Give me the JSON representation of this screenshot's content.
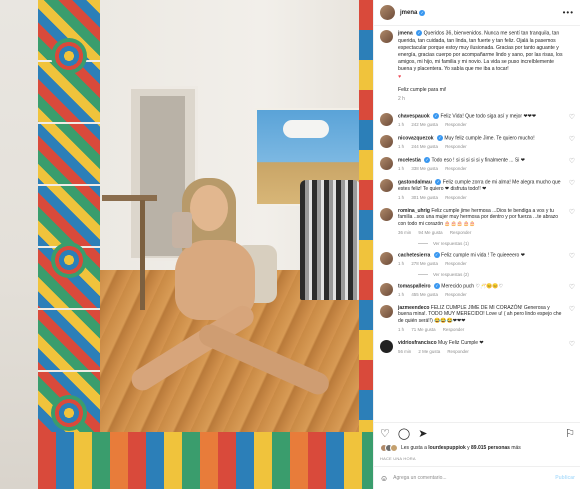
{
  "post": {
    "username": "jmena",
    "caption": "Queridos 36, bienvenidos. Nunca me sentí tan tranquila, tan querida, tan cuidada, tan linda, tan fuerte y tan feliz. Ojalá la pasemos espectacular porque estoy muy ilusionada. Gracias por tanto aguante y energía, gracias cuerpo por acompañarme lindo y sano, por las risas, los amigos, mi hijo, mi familia y mi novio. La vida se puso increíblemente buena y placentera. Yo sabía que me iba a tocar!",
    "caption_heart": "♥",
    "caption_sign": "Feliz cumple para mi!",
    "caption_time": "2 h"
  },
  "comments": [
    {
      "username": "chavespauok",
      "text": "Feliz Vida! Que todo siga así y mejor ❤❤❤",
      "time": "1 h",
      "likes": "242 Me gusta",
      "reply": "Responder"
    },
    {
      "username": "nicovazquezok",
      "text": "Muy feliz cumple Jime. Te quiero mucho!",
      "time": "1 h",
      "likes": "244 Me gusta",
      "reply": "Responder"
    },
    {
      "username": "mcelestia",
      "text": "Todo eso ! si si si si si y finalmente ... Si ❤",
      "time": "1 h",
      "likes": "338 Me gusta",
      "reply": "Responder"
    },
    {
      "username": "gastondalmau",
      "text": "Feliz cumple zorra de mi alma! Me alegra mucho que estes feliz! Te quiero ❤ disfruta todo!! ❤",
      "time": "1 h",
      "likes": "301 Me gusta",
      "reply": "Responder"
    },
    {
      "username": "romina_uhrig",
      "text": "Feliz cumple jime hermosa ...Dios te bendiga a vos y tu familia ..sos una mujer muy hermosa por dentro y por fuerza ...te abrazo con todo mi corazón 🎂🎂🎂🎂🎂",
      "time": "36 min",
      "likes": "94 Me gusta",
      "reply": "Responder",
      "replies": "Ver respuestas (1)"
    },
    {
      "username": "cachetesierra",
      "text": "Feliz cumple mi vida ! Te quieeeero ❤",
      "time": "1 h",
      "likes": "278 Me gusta",
      "reply": "Responder",
      "replies": "Ver respuestas (2)"
    },
    {
      "username": "tomaspalleiro",
      "text": "Merecido puch ♡🥂😊😊♡",
      "time": "1 h",
      "likes": "455 Me gusta",
      "reply": "Responder"
    },
    {
      "username": "jazmeendeco",
      "text": "FELIZ CUMPLE JIME DE MI CORAZÓN! Generosa y buena mina!. TODO MUY MERECIDO! Love u! ( ah pero lindo espejo che de quién será!!) 😂😂😂❤❤❤",
      "time": "1 h",
      "likes": "71 Me gusta",
      "reply": "Responder"
    },
    {
      "username": "vidriosfrancisco",
      "text": "Muy Feliz Cumple ❤",
      "time": "56 min",
      "likes": "2 Me gusta",
      "reply": "Responder"
    }
  ],
  "likes": {
    "prefix": "Les gusta a",
    "user": "lourdespuppiok",
    "middle": "y",
    "count": "89.015 personas",
    "suffix": "más"
  },
  "timestamp": "HACE UNA HORA",
  "input": {
    "placeholder": "Agrega un comentario...",
    "post": "Publicar"
  },
  "icons": {
    "more": "more-options-icon",
    "heart": "heart-icon",
    "comment": "comment-icon",
    "share": "share-icon",
    "bookmark": "bookmark-icon",
    "emoji": "emoji-icon",
    "verified": "verified-badge-icon"
  },
  "colors": {
    "link": "#3897f0",
    "muted": "#8e8e8e",
    "post_disabled": "#b2dffc"
  }
}
